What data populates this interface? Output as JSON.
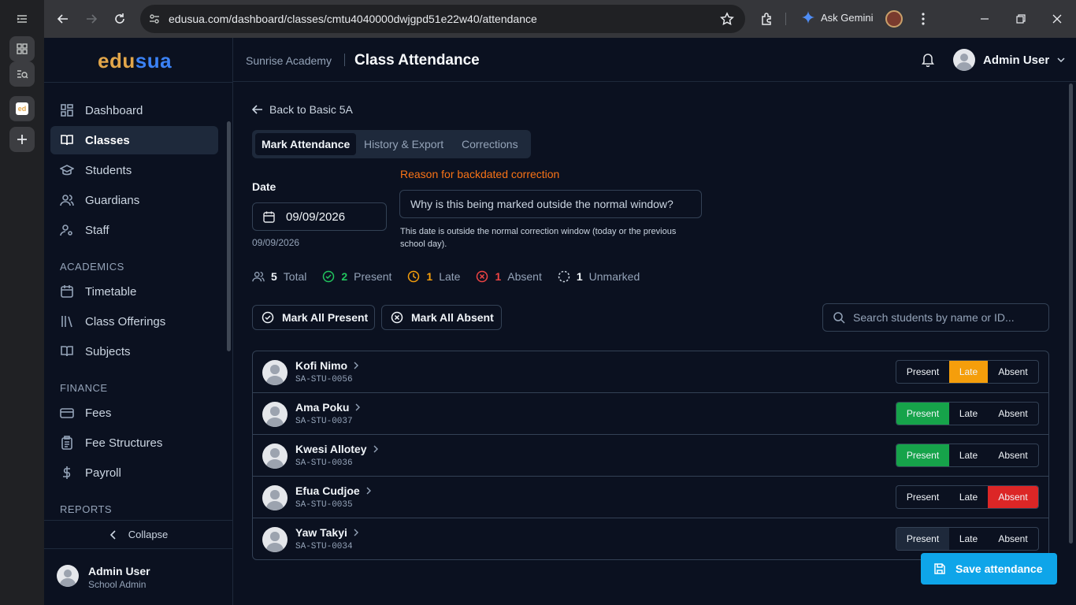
{
  "browser": {
    "url": "edusua.com/dashboard/classes/cmtu4040000dwjgpd51e22w40/attendance",
    "gemini_label": "Ask Gemini",
    "tab_favicon_text": "ed"
  },
  "app": {
    "logo_part1": "edu",
    "logo_part2": "sua",
    "colors": {
      "logo_orange": "#e2a64a",
      "logo_blue": "#3b82f6",
      "present": "#16a34a",
      "late": "#f59e0b",
      "absent": "#dc2626",
      "primary": "#0ea5e9",
      "warning_text": "#f97316"
    }
  },
  "sidebar": {
    "items": [
      {
        "label": "Dashboard",
        "icon": "grid-icon"
      },
      {
        "label": "Classes",
        "icon": "book-open-icon",
        "active": true
      },
      {
        "label": "Students",
        "icon": "graduation-cap-icon"
      },
      {
        "label": "Guardians",
        "icon": "users-icon"
      },
      {
        "label": "Staff",
        "icon": "user-cog-icon"
      }
    ],
    "section_academics": "ACADEMICS",
    "academics": [
      {
        "label": "Timetable",
        "icon": "calendar-icon"
      },
      {
        "label": "Class Offerings",
        "icon": "library-icon"
      },
      {
        "label": "Subjects",
        "icon": "book-icon"
      }
    ],
    "section_finance": "FINANCE",
    "finance": [
      {
        "label": "Fees",
        "icon": "credit-card-icon"
      },
      {
        "label": "Fee Structures",
        "icon": "clipboard-icon"
      },
      {
        "label": "Payroll",
        "icon": "dollar-icon"
      }
    ],
    "section_reports": "REPORTS",
    "collapse_label": "Collapse",
    "user_name": "Admin User",
    "user_role": "School Admin"
  },
  "header": {
    "school": "Sunrise Academy",
    "title": "Class Attendance",
    "user_name": "Admin User"
  },
  "main": {
    "back_label": "Back to Basic 5A",
    "tabs": [
      "Mark Attendance",
      "History & Export",
      "Corrections"
    ],
    "date_label": "Date",
    "date_value": "09/09/2026",
    "date_caption": "09/09/2026",
    "reason_label": "Reason for backdated correction",
    "reason_placeholder": "Why is this being marked outside the normal window?",
    "reason_help": "This date is outside the normal correction window (today or the previous school day).",
    "stats": {
      "total": "5",
      "total_label": "Total",
      "present": "2",
      "present_label": "Present",
      "late": "1",
      "late_label": "Late",
      "absent": "1",
      "absent_label": "Absent",
      "unmarked": "1",
      "unmarked_label": "Unmarked"
    },
    "mark_all_present": "Mark All Present",
    "mark_all_absent": "Mark All Absent",
    "search_placeholder": "Search students by name or ID...",
    "seg_labels": {
      "present": "Present",
      "late": "Late",
      "absent": "Absent"
    },
    "students": [
      {
        "name": "Kofi Nimo",
        "id": "SA-STU-0056",
        "status": "late"
      },
      {
        "name": "Ama Poku",
        "id": "SA-STU-0037",
        "status": "present"
      },
      {
        "name": "Kwesi Allotey",
        "id": "SA-STU-0036",
        "status": "present"
      },
      {
        "name": "Efua Cudjoe",
        "id": "SA-STU-0035",
        "status": "absent"
      },
      {
        "name": "Yaw Takyi",
        "id": "SA-STU-0034",
        "status": "unmarked"
      }
    ],
    "save_label": "Save attendance"
  }
}
